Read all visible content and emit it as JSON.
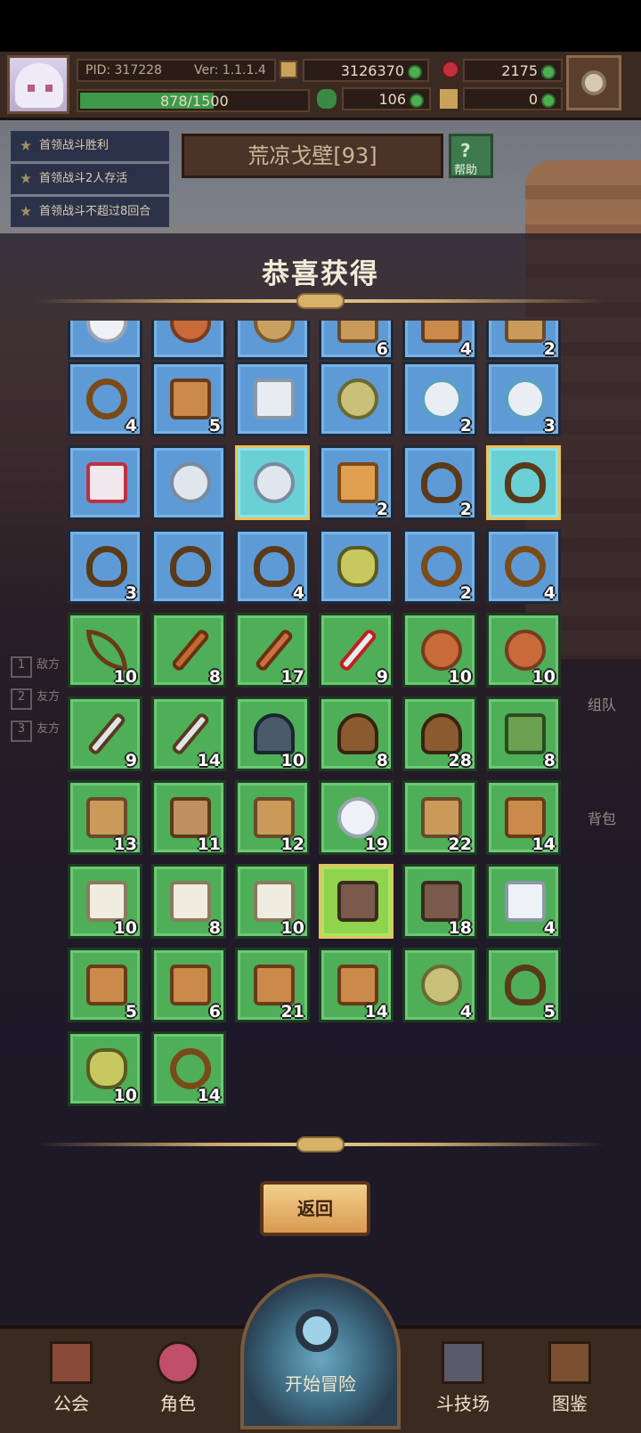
{
  "header": {
    "pid": "PID: 317228",
    "version": "Ver: 1.1.1.4",
    "gold": "3126370",
    "gems": "2175",
    "exp": "878/1500",
    "clover": "106",
    "keys": "0"
  },
  "quests": [
    "首领战斗胜利",
    "首领战斗2人存活",
    "首领战斗不超过8回合"
  ],
  "stage": {
    "name": "荒凉戈壁[93]",
    "help_label": "帮助"
  },
  "side_hints": {
    "list": [
      "敌方",
      "友方",
      "友方"
    ],
    "numbers": [
      "1",
      "2",
      "3"
    ]
  },
  "reward": {
    "title": "恭喜获得",
    "return_label": "返回",
    "rows": [
      [
        {
          "item": "plate",
          "q": "blue",
          "c": ""
        },
        {
          "item": "shield",
          "q": "blue",
          "c": ""
        },
        {
          "item": "bowl",
          "q": "blue",
          "c": ""
        },
        {
          "item": "armor",
          "q": "blue",
          "c": "6"
        },
        {
          "item": "boots",
          "q": "blue",
          "c": "4"
        },
        {
          "item": "armor",
          "q": "blue",
          "c": "2"
        }
      ],
      [
        {
          "item": "ring",
          "q": "blue",
          "c": "4"
        },
        {
          "item": "boots",
          "q": "blue",
          "c": "5"
        },
        {
          "item": "greave",
          "q": "blue",
          "c": ""
        },
        {
          "item": "coin",
          "q": "blue",
          "c": ""
        },
        {
          "item": "gem-disc",
          "q": "blue",
          "c": "2"
        },
        {
          "item": "gem-disc",
          "q": "blue",
          "c": "3"
        }
      ],
      [
        {
          "item": "heart-box",
          "q": "blue",
          "c": ""
        },
        {
          "item": "crystal",
          "q": "blue",
          "c": ""
        },
        {
          "item": "crystal",
          "q": "cyan",
          "c": ""
        },
        {
          "item": "star",
          "q": "blue",
          "c": "2"
        },
        {
          "item": "necklace",
          "q": "blue",
          "c": "2"
        },
        {
          "item": "necklace",
          "q": "cyan",
          "c": ""
        }
      ],
      [
        {
          "item": "necklace",
          "q": "blue",
          "c": "3"
        },
        {
          "item": "necklace",
          "q": "blue",
          "c": ""
        },
        {
          "item": "necklace",
          "q": "blue",
          "c": "4"
        },
        {
          "item": "potion",
          "q": "blue",
          "c": ""
        },
        {
          "item": "ring",
          "q": "blue",
          "c": "2"
        },
        {
          "item": "ring",
          "q": "blue",
          "c": "4"
        }
      ],
      [
        {
          "item": "bow",
          "q": "green",
          "c": "10"
        },
        {
          "item": "staff",
          "q": "green",
          "c": "8"
        },
        {
          "item": "wand",
          "q": "green",
          "c": "17"
        },
        {
          "item": "sword",
          "q": "green",
          "c": "9"
        },
        {
          "item": "shield",
          "q": "green",
          "c": "10"
        },
        {
          "item": "shield",
          "q": "green",
          "c": "10"
        }
      ],
      [
        {
          "item": "dagger",
          "q": "green",
          "c": "9"
        },
        {
          "item": "dagger",
          "q": "green",
          "c": "14"
        },
        {
          "item": "hat",
          "q": "green",
          "c": "10"
        },
        {
          "item": "hood",
          "q": "green",
          "c": "8"
        },
        {
          "item": "hood",
          "q": "green",
          "c": "28"
        },
        {
          "item": "cloak",
          "q": "green",
          "c": "8"
        }
      ],
      [
        {
          "item": "armor",
          "q": "green",
          "c": "13"
        },
        {
          "item": "coat",
          "q": "green",
          "c": "11"
        },
        {
          "item": "armor",
          "q": "green",
          "c": "12"
        },
        {
          "item": "plate",
          "q": "green",
          "c": "19"
        },
        {
          "item": "armor",
          "q": "green",
          "c": "22"
        },
        {
          "item": "boots",
          "q": "green",
          "c": "14"
        }
      ],
      [
        {
          "item": "glove",
          "q": "green",
          "c": "10"
        },
        {
          "item": "glove",
          "q": "green",
          "c": "8"
        },
        {
          "item": "glove",
          "q": "green",
          "c": "10"
        },
        {
          "item": "bracer",
          "q": "lime",
          "c": ""
        },
        {
          "item": "bracer",
          "q": "green",
          "c": "18"
        },
        {
          "item": "belt",
          "q": "green",
          "c": "4"
        }
      ],
      [
        {
          "item": "boots",
          "q": "green",
          "c": "5"
        },
        {
          "item": "boots",
          "q": "green",
          "c": "6"
        },
        {
          "item": "boots",
          "q": "green",
          "c": "21"
        },
        {
          "item": "boots",
          "q": "green",
          "c": "14"
        },
        {
          "item": "coin",
          "q": "green",
          "c": "4"
        },
        {
          "item": "necklace",
          "q": "green",
          "c": "5"
        }
      ],
      [
        {
          "item": "potion",
          "q": "green",
          "c": "10"
        },
        {
          "item": "ring",
          "q": "green",
          "c": "14"
        }
      ]
    ]
  },
  "side_buttons": {
    "team": "组队",
    "bag": "背包"
  },
  "nav": [
    {
      "label": "公会",
      "icon": "guild-icon"
    },
    {
      "label": "角色",
      "icon": "character-icon"
    },
    {
      "label": "开始冒险",
      "icon": "magnifier-icon"
    },
    {
      "label": "斗技场",
      "icon": "crossed-swords-icon"
    },
    {
      "label": "图鉴",
      "icon": "book-icon"
    }
  ],
  "colors": {
    "blue": "#5e9bd6",
    "green": "#4fae58",
    "cyan": "#6ad0d6",
    "lime": "#8fd44c",
    "gold": "#e8c25c"
  }
}
